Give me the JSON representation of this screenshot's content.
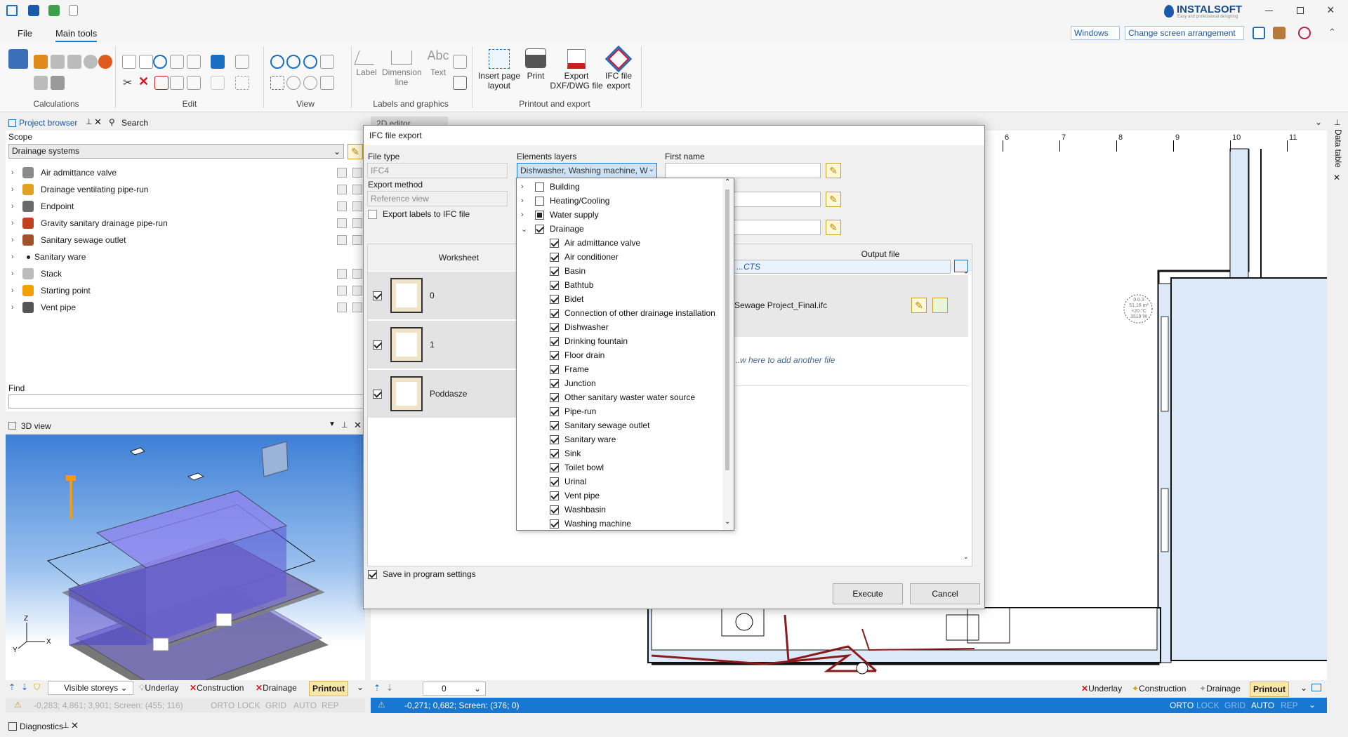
{
  "window": {
    "brand": "INSTALSOFT",
    "brand_tag": "Easy and professional designing",
    "windows_btn": "Windows",
    "screen_arr_btn": "Change screen arrangement"
  },
  "ribbon": {
    "tabs": [
      "File",
      "Main tools"
    ],
    "groups": {
      "calculations": "Calculations",
      "edit": "Edit",
      "view": "View",
      "labels": "Labels and graphics",
      "printout": "Printout and export"
    },
    "label_btn": "Label",
    "dimension_btn": "Dimension line",
    "text_btn": "Text",
    "text_icon": "Abc",
    "insert_page_btn": "Insert page layout",
    "print_btn": "Print",
    "export_dxf_btn": "Export DXF/DWG file",
    "ifc_export_btn": "IFC file export"
  },
  "project_browser": {
    "tab": "Project browser",
    "search_tab": "Search",
    "scope_label": "Scope",
    "scope_value": "Drainage systems",
    "items": [
      {
        "label": "Air admittance valve",
        "color": "#8a8a8a"
      },
      {
        "label": "Drainage ventilating pipe-run",
        "color": "#e0a020"
      },
      {
        "label": "Endpoint",
        "color": "#6a6a6a"
      },
      {
        "label": "Gravity sanitary drainage pipe-run",
        "color": "#c04020"
      },
      {
        "label": "Sanitary sewage outlet",
        "color": "#a0522d"
      },
      {
        "label": "Sanitary ware",
        "color": "#222222"
      },
      {
        "label": "Stack",
        "color": "#bbbbbb"
      },
      {
        "label": "Starting point",
        "color": "#f0a000"
      },
      {
        "label": "Vent pipe",
        "color": "#555555"
      }
    ],
    "find_label": "Find"
  },
  "view3d": {
    "title": "3D view",
    "toolbar": {
      "visible_storeys": "Visible storeys",
      "underlay": "Underlay",
      "construction": "Construction",
      "drainage": "Drainage",
      "printout": "Printout"
    },
    "status": "-0,283; 4,861; 3,901; Screen: (455; 116)",
    "flags": [
      "ORTO",
      "LOCK",
      "GRID",
      "AUTO",
      "REP"
    ]
  },
  "diagnostics": {
    "title": "Diagnostics"
  },
  "drawing": {
    "tab": "2D editor",
    "ruler": [
      "6",
      "7",
      "8",
      "9",
      "10",
      "11"
    ],
    "room_tag": [
      "0.0.3",
      "51,16 m²",
      "+20 °C",
      "3519 W"
    ],
    "storey_value": "0",
    "toolbar": {
      "underlay": "Underlay",
      "construction": "Construction",
      "drainage": "Drainage",
      "printout": "Printout"
    },
    "status": "-0,271; 0,682; Screen: (376; 0)",
    "flags": [
      "ORTO",
      "LOCK",
      "GRID",
      "AUTO",
      "REP"
    ],
    "side_tab": "Data table"
  },
  "dialog": {
    "title": "IFC file export",
    "file_type_label": "File type",
    "file_type_value": "IFC4",
    "export_method_label": "Export method",
    "export_method_value": "Reference view",
    "export_labels": "Export labels to IFC file",
    "elements_layers_label": "Elements layers",
    "elements_layers_value": "Dishwasher, Washing machine, W",
    "first_name_label": "First name",
    "worksheet_header": "Worksheet",
    "output_header": "Output file",
    "output_path": "...CTS",
    "output_file": "Sewage Project_Final.ifc",
    "add_file_hint": "...w here to add another file",
    "worksheets": [
      "0",
      "1",
      "Poddasze"
    ],
    "save_settings": "Save in program settings",
    "execute_btn": "Execute",
    "cancel_btn": "Cancel",
    "layer_groups": [
      {
        "label": "Building",
        "state": "off",
        "expanded": false
      },
      {
        "label": "Heating/Cooling",
        "state": "off",
        "expanded": false
      },
      {
        "label": "Water supply",
        "state": "partial",
        "expanded": false
      },
      {
        "label": "Drainage",
        "state": "on",
        "expanded": true
      }
    ],
    "drainage_layers": [
      "Air admittance valve",
      "Air conditioner",
      "Basin",
      "Bathtub",
      "Bidet",
      "Connection of other drainage installation",
      "Dishwasher",
      "Drinking fountain",
      "Floor drain",
      "Frame",
      "Junction",
      "Other sanitary waster water source",
      "Pipe-run",
      "Sanitary sewage outlet",
      "Sanitary ware",
      "Sink",
      "Toilet bowl",
      "Urinal",
      "Vent pipe",
      "Washbasin",
      "Washing machine"
    ]
  },
  "colors": {
    "accent": "#1777d1",
    "selection": "#cfe3f6",
    "wall": "#111111",
    "room_fill": "#dbe9f8",
    "pipe": "#8b1a1a"
  }
}
